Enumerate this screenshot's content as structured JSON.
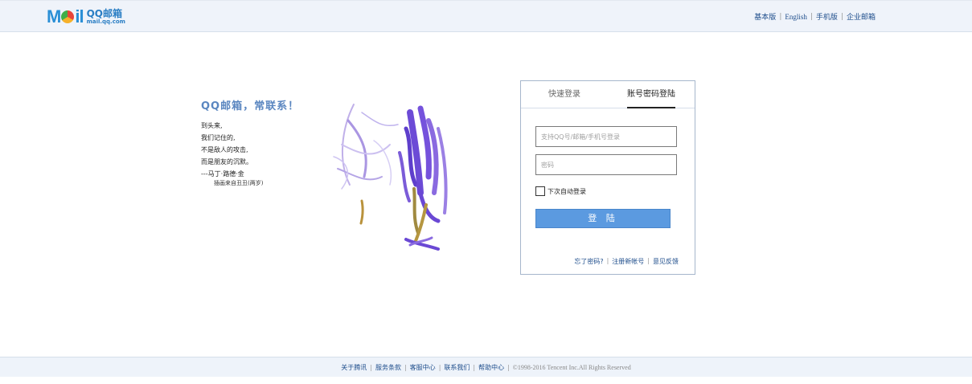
{
  "header": {
    "logo_wordmark": "MOil",
    "logo_cn": "QQ邮箱",
    "logo_url": "mail.qq.com",
    "links": [
      "基本版",
      "English",
      "手机版",
      "企业邮箱"
    ]
  },
  "intro": {
    "slogan": "QQ邮箱，常联系！",
    "poem": [
      "到头来,",
      "我们记住的,",
      "不是敌人的攻击,",
      "而是朋友的沉默。",
      "---马丁·路德·金"
    ],
    "credit": "插画来自丑丑(两岁)"
  },
  "login": {
    "tabs": [
      "快速登录",
      "账号密码登陆"
    ],
    "active_tab": 1,
    "username_placeholder": "支持QQ号/邮箱/手机号登录",
    "password_placeholder": "密码",
    "remember_label": "下次自动登录",
    "remember_checked": false,
    "login_button": "登 陆",
    "links": [
      "忘了密码?",
      "注册新帐号",
      "意见反馈"
    ]
  },
  "footer": {
    "links": [
      "关于腾讯",
      "服务条款",
      "客服中心",
      "联系我们",
      "帮助中心"
    ],
    "copyright": "©1998-2016 Tencent Inc.All Rights Reserved"
  },
  "colors": {
    "accent": "#5b9ae0",
    "link": "#1f4e8c",
    "slogan": "#5a86c0",
    "header_bg": "#eff3fa"
  }
}
